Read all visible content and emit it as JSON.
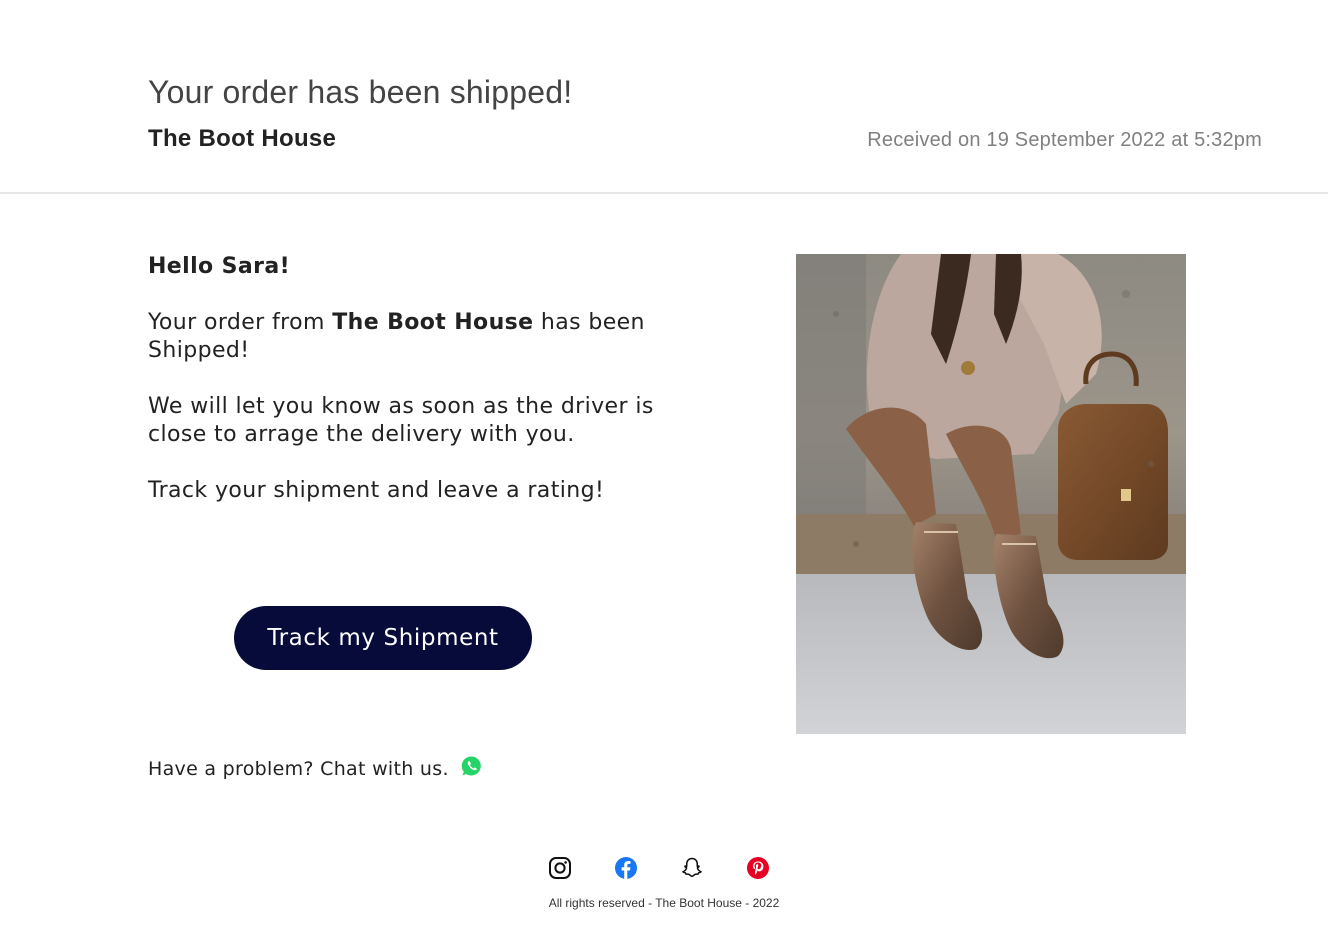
{
  "header": {
    "title": "Your order has been shipped!",
    "shop_name": "The Boot House",
    "received": "Received on 19 September 2022 at 5:32pm"
  },
  "message": {
    "greeting": "Hello Sara!",
    "line1_prefix": "Your order from ",
    "line1_shop": "The Boot House",
    "line1_suffix": " has been Shipped!",
    "line2": "We will let you know as soon as the driver is close to arrage the delivery with you.",
    "line3": "Track your shipment and leave a rating!"
  },
  "cta": {
    "track_label": "Track my Shipment",
    "button_color": "#070b3a"
  },
  "support": {
    "chat_text": "Have a problem? Chat with us.",
    "chat_icon": "whatsapp-icon"
  },
  "product_image": {
    "subject": "woman in rose-gold lace-up boots with brown handbag"
  },
  "footer": {
    "social_icons": [
      "instagram-icon",
      "facebook-icon",
      "snapchat-icon",
      "pinterest-icon"
    ],
    "copyright": "All rights reserved - The Boot House - 2022"
  },
  "colors": {
    "whatsapp": "#25d366",
    "facebook": "#1877f2",
    "pinterest": "#e60023"
  }
}
